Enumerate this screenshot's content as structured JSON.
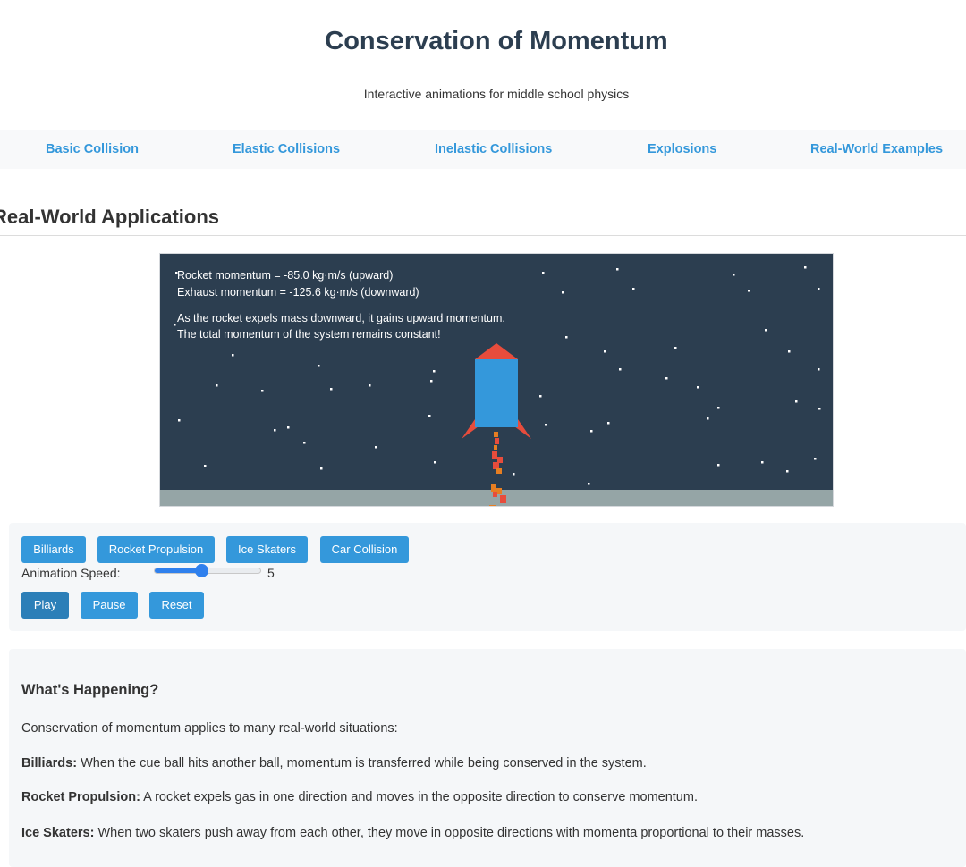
{
  "header": {
    "title": "Conservation of Momentum",
    "subtitle": "Interactive animations for middle school physics"
  },
  "nav": {
    "items": [
      "Basic Collision",
      "Elastic Collisions",
      "Inelastic Collisions",
      "Explosions",
      "Real-World Examples"
    ]
  },
  "section": {
    "title": "Real-World Applications"
  },
  "canvas": {
    "lines": [
      "Rocket momentum = -85.0 kg·m/s (upward)",
      "Exhaust momentum = -125.6 kg·m/s (downward)",
      "As the rocket expels mass downward, it gains upward momentum.",
      "The total momentum of the system remains constant!"
    ],
    "colors": {
      "sky": "#2c3e50",
      "ground": "#95a5a6",
      "rocket_body": "#3498db",
      "rocket_fins": "#e74c3c",
      "flame_red": "#e74c3c",
      "flame_orange": "#e67e22"
    }
  },
  "controls": {
    "scenarios": [
      "Billiards",
      "Rocket Propulsion",
      "Ice Skaters",
      "Car Collision"
    ],
    "speed_label": "Animation Speed:",
    "speed_value": "5",
    "speed_min": 1,
    "speed_max": 10,
    "play_label": "Play",
    "pause_label": "Pause",
    "reset_label": "Reset"
  },
  "info": {
    "title": "What's Happening?",
    "intro": "Conservation of momentum applies to many real-world situations:",
    "items": [
      {
        "term": "Billiards:",
        "text": " When the cue ball hits another ball, momentum is transferred while being conserved in the system."
      },
      {
        "term": "Rocket Propulsion:",
        "text": " A rocket expels gas in one direction and moves in the opposite direction to conserve momentum."
      },
      {
        "term": "Ice Skaters:",
        "text": " When two skaters push away from each other, they move in opposite directions with momenta proportional to their masses."
      }
    ]
  }
}
